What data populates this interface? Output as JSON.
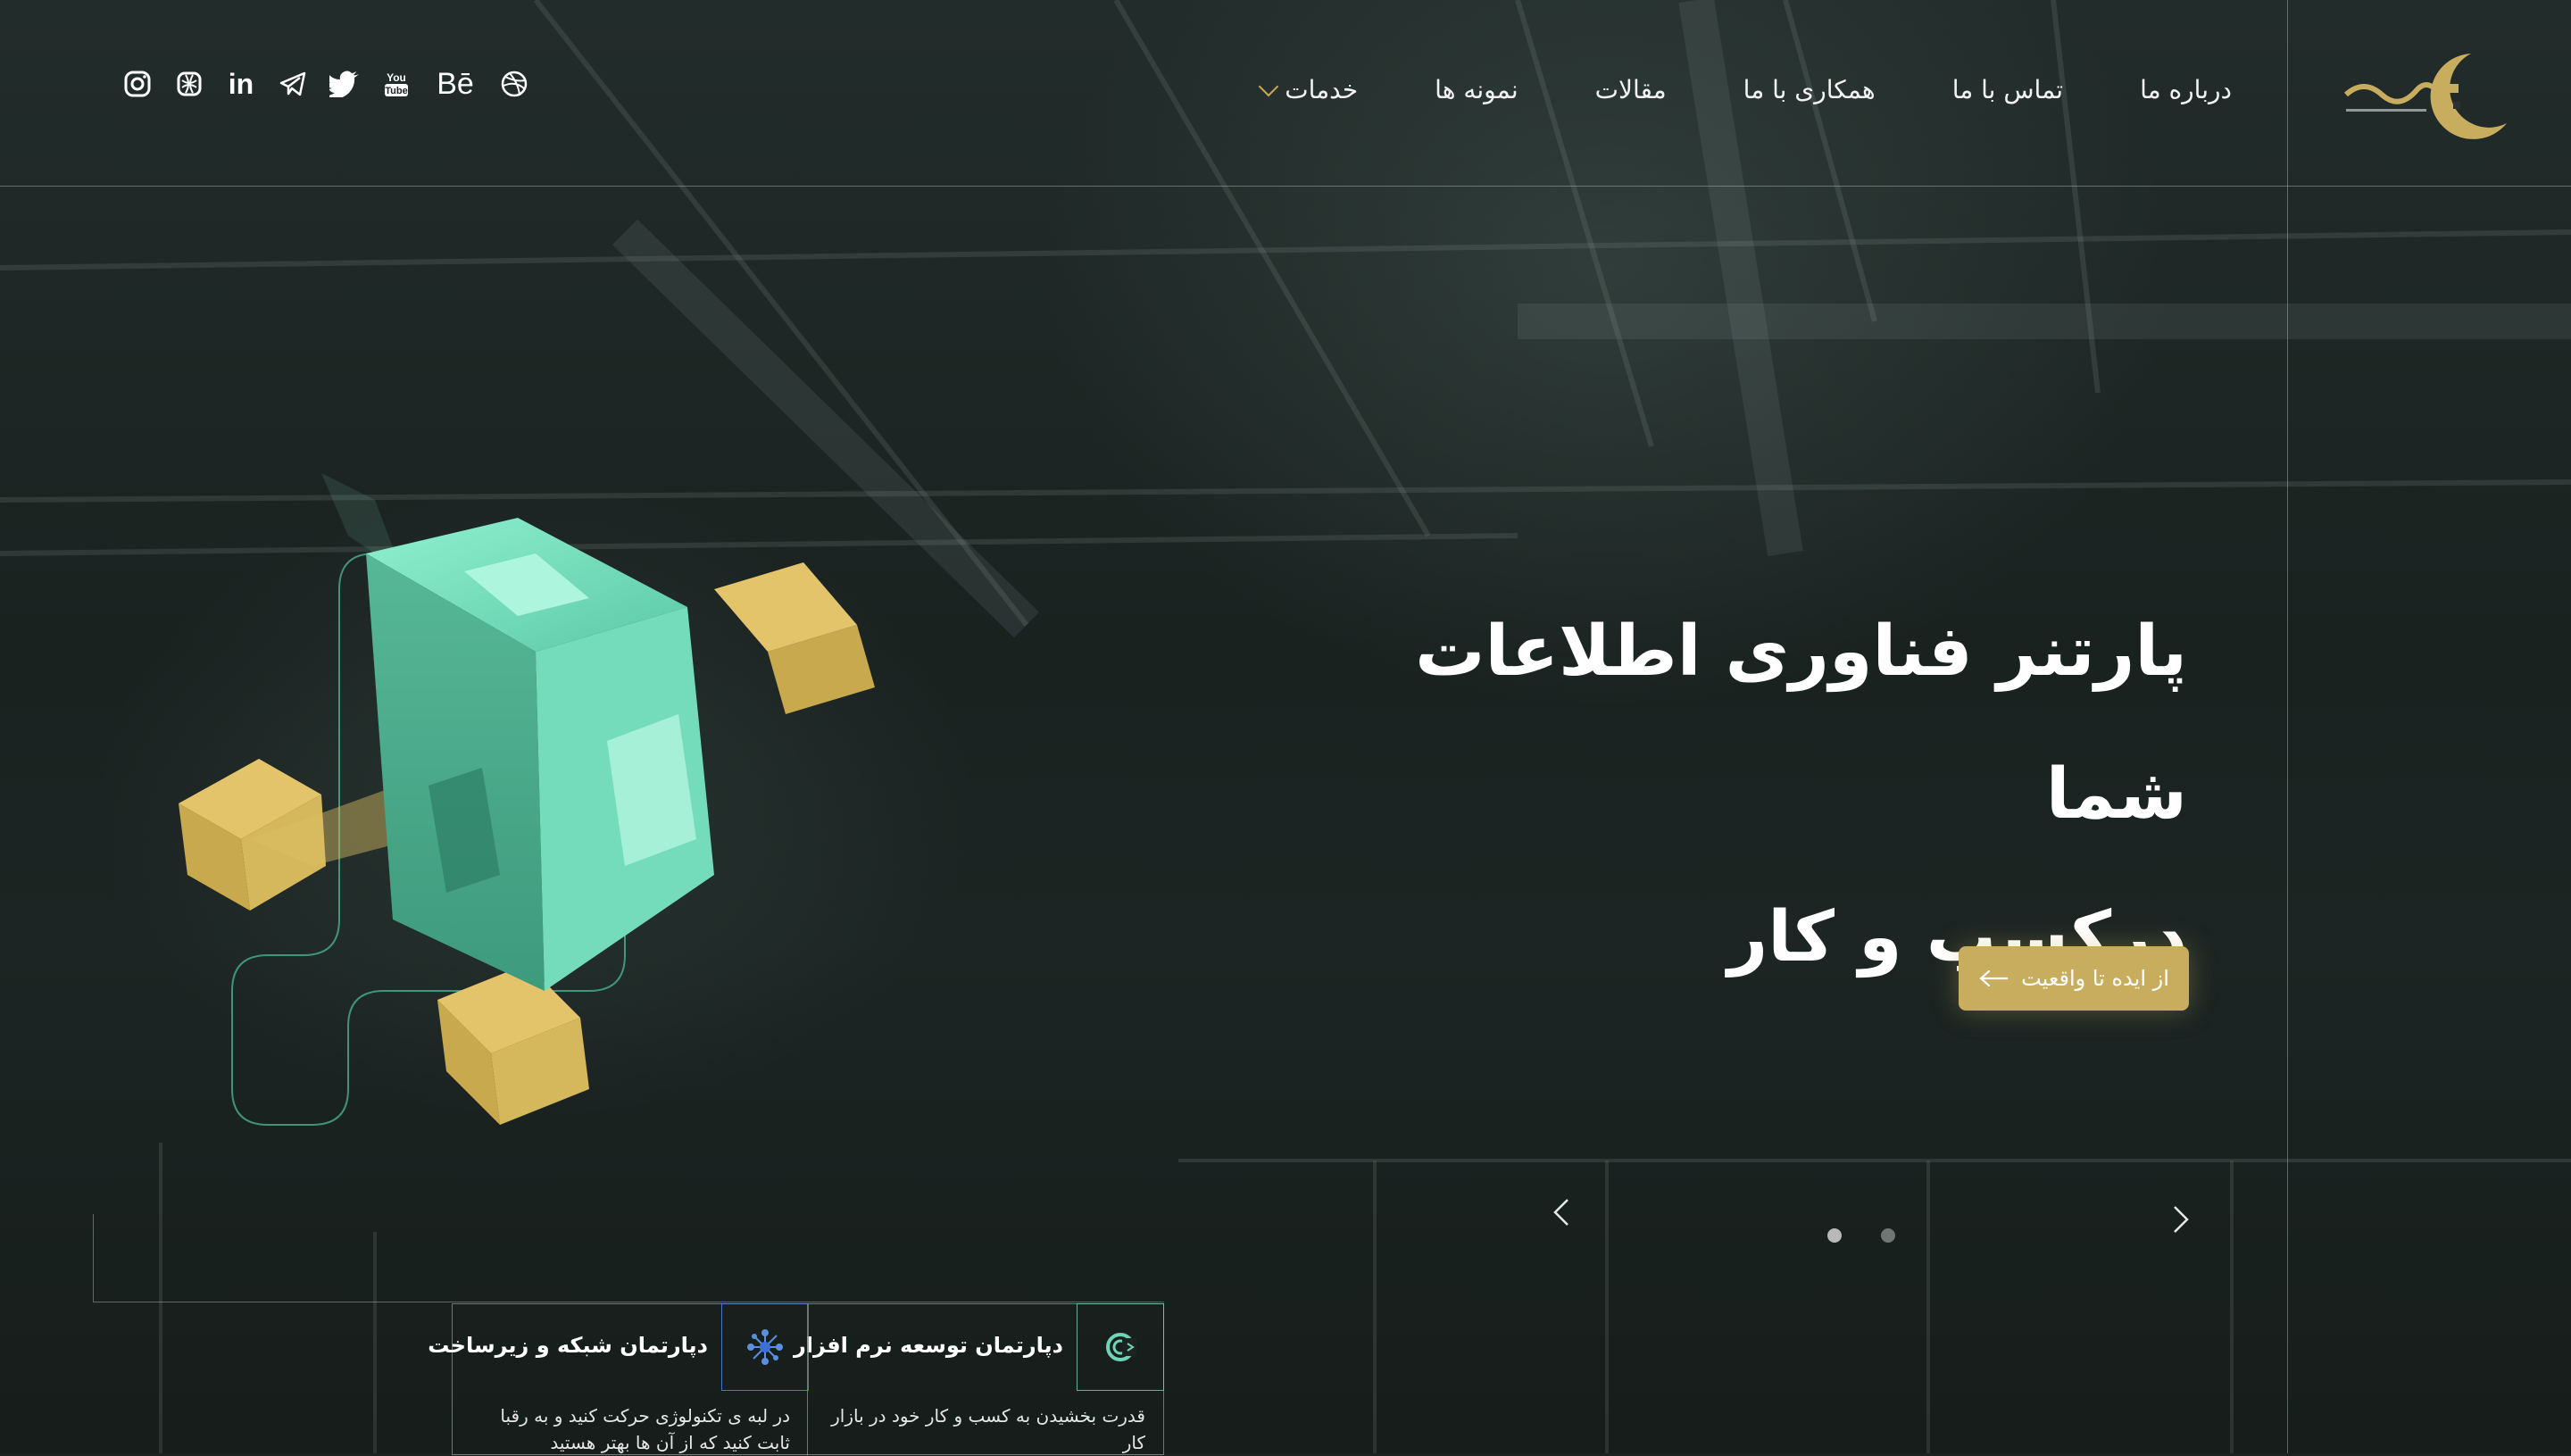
{
  "brand": {
    "logo_icon": "crescent-logo-icon",
    "accent_color": "#c9ad5e",
    "teal_color": "#6fd3b5"
  },
  "nav": {
    "items": [
      {
        "label": "خدمات",
        "has_dropdown": true
      },
      {
        "label": "نمونه ها"
      },
      {
        "label": "مقالات"
      },
      {
        "label": "همکاری با ما"
      },
      {
        "label": "تماس با ما"
      },
      {
        "label": "درباره ما"
      }
    ]
  },
  "socials": [
    {
      "icon": "dribbble-icon"
    },
    {
      "icon": "behance-icon",
      "text": "Bē"
    },
    {
      "icon": "youtube-icon"
    },
    {
      "icon": "twitter-icon"
    },
    {
      "icon": "telegram-icon"
    },
    {
      "icon": "linkedin-icon",
      "text": "in"
    },
    {
      "icon": "globe-icon"
    },
    {
      "icon": "instagram-icon"
    }
  ],
  "hero": {
    "title_line1": "پارتنر فناوری اطلاعات شما",
    "title_line2": "درکسب و کار",
    "cta_label": "از ایده تا واقعیت",
    "cta_icon": "arrow-left-icon",
    "slides": {
      "count": 2,
      "active": 1
    }
  },
  "departments": [
    {
      "title": "دپارتمان توسعه نرم افزار",
      "desc": "قدرت بخشیدن به کسب و کار خود در بازار کار",
      "icon": "software-icon"
    },
    {
      "title": "دپارتمان شبکه و زیرساخت",
      "desc": "در لبه ی تکنولوژی حرکت کنید و به رقبا ثابت کنید که از آن ها بهتر هستید",
      "icon": "network-icon"
    }
  ]
}
